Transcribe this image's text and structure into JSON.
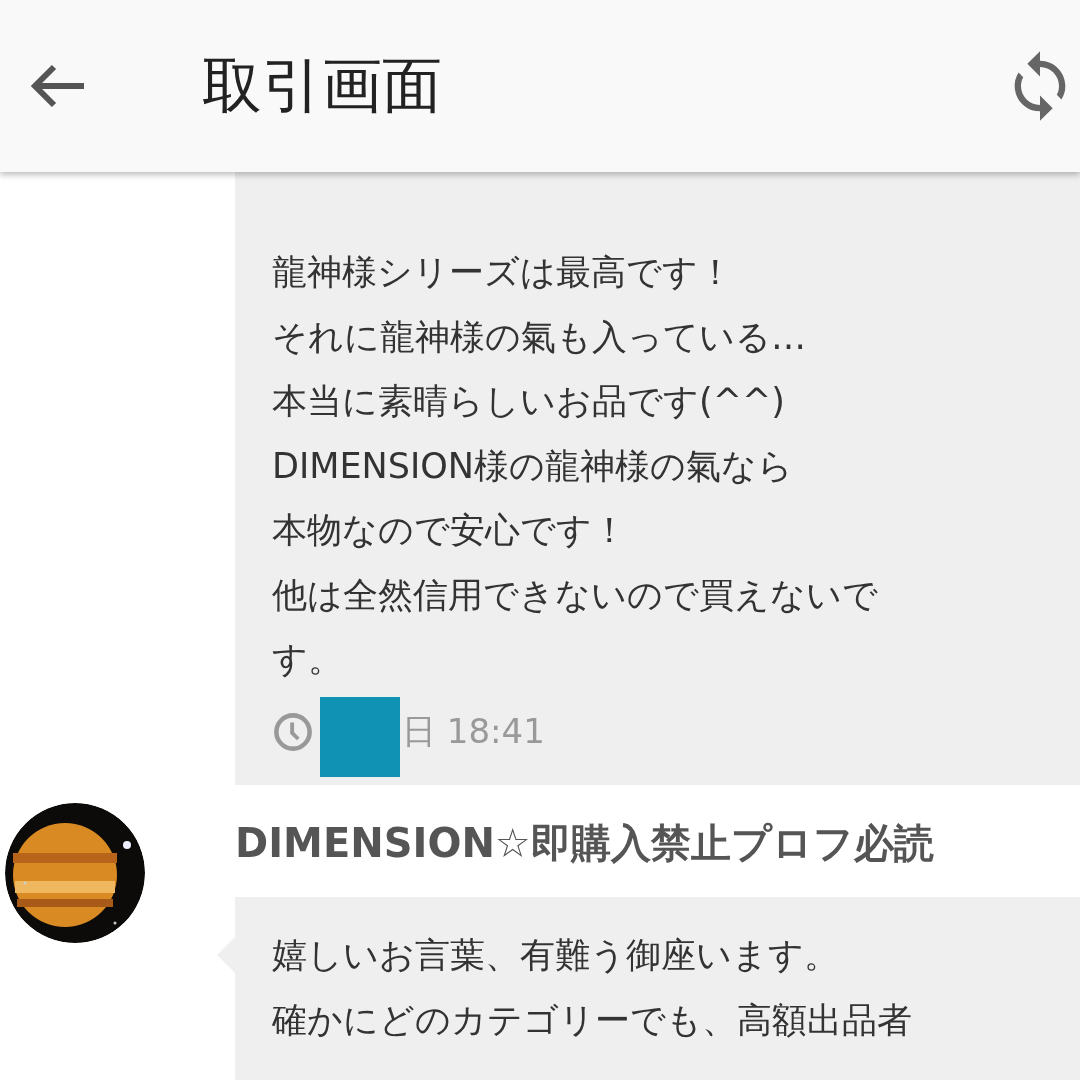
{
  "app_bar": {
    "title": "取引画面"
  },
  "messages": [
    {
      "kind": "incoming",
      "lines": [
        "龍神様シリーズは最高です！",
        "それに龍神様の氣も入っている…",
        "本当に素晴らしいお品です(^^)",
        "DIMENSION様の龍神様の氣なら",
        "本物なので安心です！",
        "他は全然信用できないので買えないで",
        "す。"
      ],
      "time": "日 18:41"
    },
    {
      "kind": "reply",
      "sender": "DIMENSION☆即購入禁止プロフ必読",
      "lines": [
        "嬉しいお言葉、有難う御座います。",
        "確かにどのカテゴリーでも、高額出品者"
      ]
    }
  ]
}
